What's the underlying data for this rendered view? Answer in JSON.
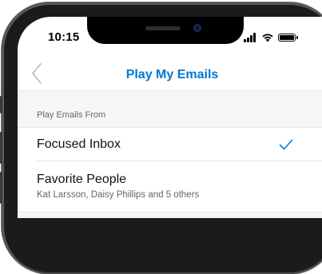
{
  "status_bar": {
    "time": "10:15"
  },
  "navbar": {
    "title": "Play My Emails",
    "back_icon": "chevron-left-icon"
  },
  "section": {
    "header": "Play Emails From"
  },
  "options": [
    {
      "title": "Focused Inbox",
      "subtitle": "",
      "selected": true
    },
    {
      "title": "Favorite People",
      "subtitle": "Kat Larsson, Daisy Phillips and 5 others",
      "selected": false
    }
  ],
  "colors": {
    "accent": "#0078d4",
    "section_bg": "#f6f6f6",
    "frame": "#1b1b1d"
  }
}
